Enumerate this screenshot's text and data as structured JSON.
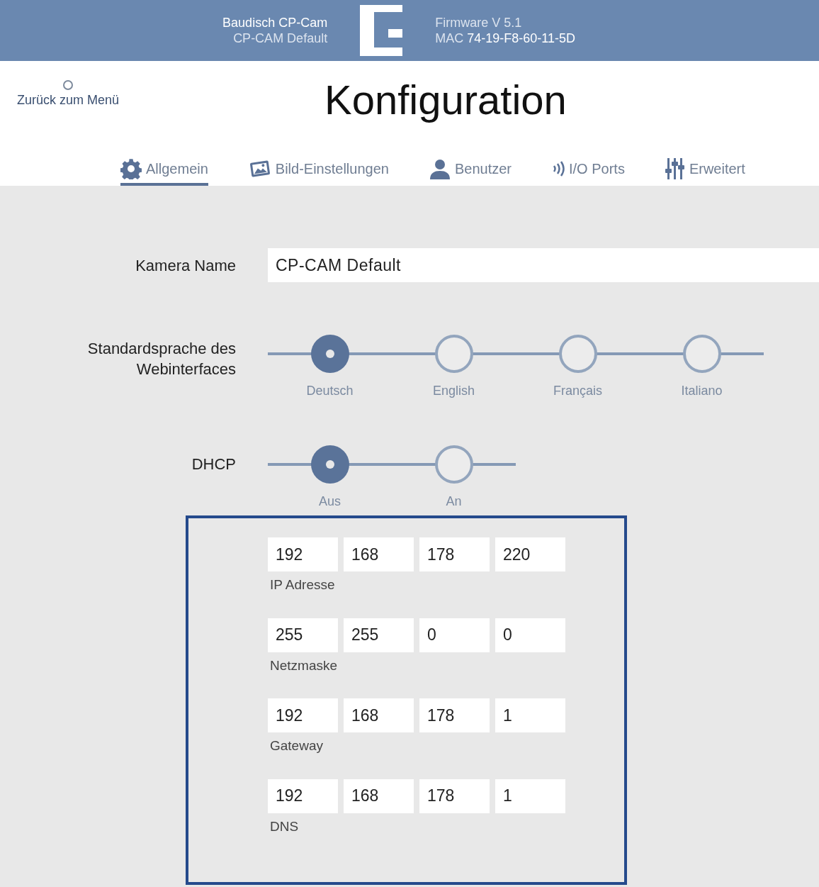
{
  "header": {
    "product": "Baudisch CP-Cam",
    "camera": "CP-CAM Default",
    "firmware": "Firmware V 5.1",
    "mac_label": "MAC",
    "mac": "74-19-F8-60-11-5D"
  },
  "back_link": "Zurück zum Menü",
  "title": "Konfiguration",
  "tabs": [
    {
      "label": "Allgemein",
      "kind": "gear",
      "selected": true
    },
    {
      "label": "Bild-Einstellungen",
      "kind": "image",
      "selected": false
    },
    {
      "label": "Benutzer",
      "kind": "user",
      "selected": false
    },
    {
      "label": "I/O Ports",
      "kind": "signal",
      "selected": false
    },
    {
      "label": "Erweitert",
      "kind": "sliders",
      "selected": false
    }
  ],
  "camera_name": {
    "label": "Kamera Name",
    "value": "CP-CAM Default"
  },
  "language": {
    "label": "Standardsprache des Webinterfaces",
    "options": [
      {
        "label": "Deutsch",
        "selected": true
      },
      {
        "label": "English",
        "selected": false
      },
      {
        "label": "Français",
        "selected": false
      },
      {
        "label": "Italiano",
        "selected": false
      }
    ]
  },
  "dhcp": {
    "label": "DHCP",
    "options": [
      {
        "label": "Aus",
        "selected": true
      },
      {
        "label": "An",
        "selected": false
      }
    ]
  },
  "network": [
    {
      "label": "IP Adresse",
      "octets": [
        "192",
        "168",
        "178",
        "220"
      ]
    },
    {
      "label": "Netzmaske",
      "octets": [
        "255",
        "255",
        "0",
        "0"
      ]
    },
    {
      "label": "Gateway",
      "octets": [
        "192",
        "168",
        "178",
        "1"
      ]
    },
    {
      "label": "DNS",
      "octets": [
        "192",
        "168",
        "178",
        "1"
      ]
    }
  ]
}
